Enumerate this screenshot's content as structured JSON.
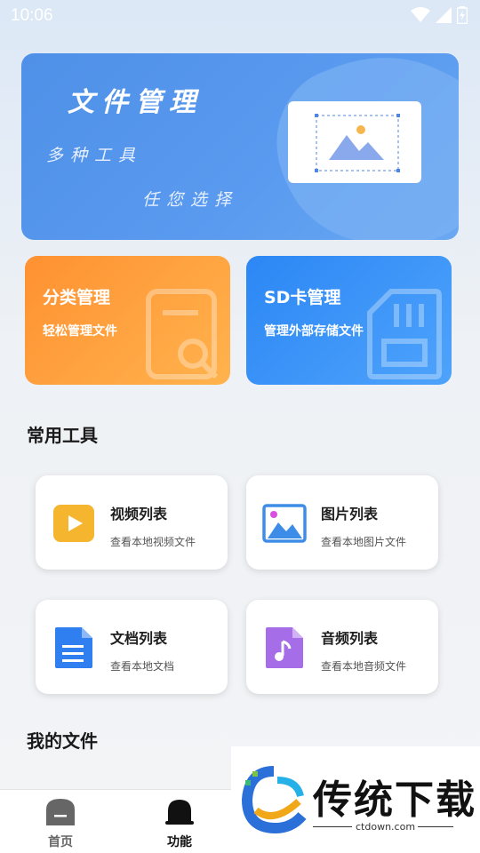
{
  "status_bar": {
    "time": "10:06"
  },
  "banner": {
    "title": "文件管理",
    "line1": "多种工具",
    "line2": "任您选择"
  },
  "feature_cards": [
    {
      "title": "分类管理",
      "subtitle": "轻松管理文件",
      "color": "#ff9a3a"
    },
    {
      "title": "SD卡管理",
      "subtitle": "管理外部存储文件",
      "color": "#2e8af7"
    }
  ],
  "sections": {
    "tools_title": "常用工具",
    "my_files_title": "我的文件"
  },
  "tools": [
    {
      "title": "视频列表",
      "subtitle": "查看本地视频文件",
      "icon": "video-icon",
      "color": "#f5b52e"
    },
    {
      "title": "图片列表",
      "subtitle": "查看本地图片文件",
      "icon": "image-icon",
      "color": "#3d8de8"
    },
    {
      "title": "文档列表",
      "subtitle": "查看本地文档",
      "icon": "document-icon",
      "color": "#2f7ff0"
    },
    {
      "title": "音频列表",
      "subtitle": "查看本地音频文件",
      "icon": "music-icon",
      "color": "#a56de8"
    }
  ],
  "bottom_nav": [
    {
      "label": "首页",
      "icon": "home-icon",
      "active": false
    },
    {
      "label": "功能",
      "icon": "function-icon",
      "active": true
    }
  ],
  "watermark": {
    "text": "传统下载",
    "url": "ctdown.com"
  }
}
